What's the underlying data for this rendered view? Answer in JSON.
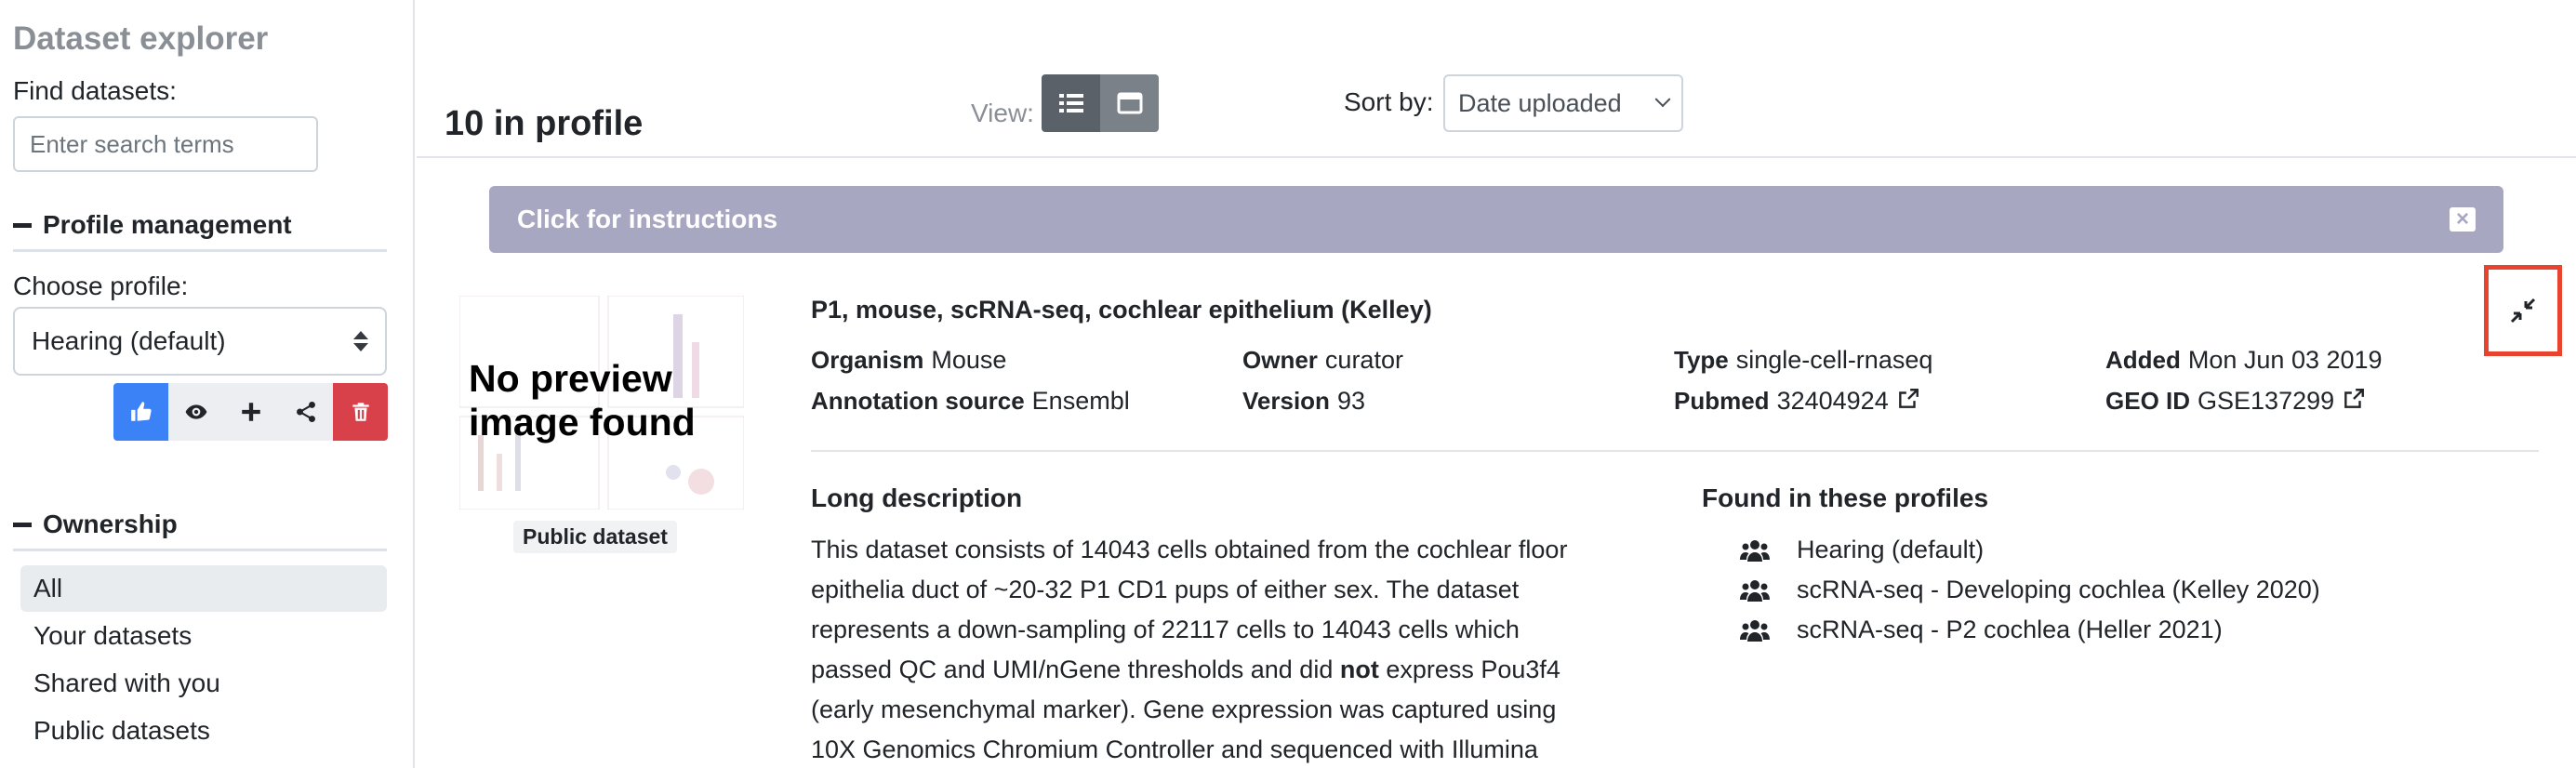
{
  "sidebar": {
    "app_title": "Dataset explorer",
    "find_label": "Find datasets:",
    "search_placeholder": "Enter search terms",
    "profile_section": "Profile management",
    "choose_profile_label": "Choose profile:",
    "selected_profile": "Hearing (default)",
    "profile_action_icons": [
      "thumbs-up-icon",
      "eye-icon",
      "plus-icon",
      "share-icon",
      "trash-icon"
    ],
    "ownership_section": "Ownership",
    "ownership_items": [
      {
        "label": "All",
        "active": true
      },
      {
        "label": "Your datasets",
        "active": false
      },
      {
        "label": "Shared with you",
        "active": false
      },
      {
        "label": "Public datasets",
        "active": false
      }
    ]
  },
  "toolbar": {
    "count_title": "10 in profile",
    "view_label": "View:",
    "view_modes": [
      "list-view-icon",
      "grid-view-icon"
    ],
    "sort_label": "Sort by:",
    "sort_value": "Date uploaded"
  },
  "instructions": {
    "label": "Click for instructions"
  },
  "dataset": {
    "preview_text_line1": "No preview",
    "preview_text_line2": "image found",
    "access": "Public dataset",
    "title": "P1, mouse, scRNA-seq, cochlear epithelium (Kelley)",
    "organism_label": "Organism",
    "organism": "Mouse",
    "annotation_label": "Annotation source",
    "annotation": "Ensembl",
    "owner_label": "Owner",
    "owner": "curator",
    "version_label": "Version",
    "version": "93",
    "type_label": "Type",
    "type": "single-cell-rnaseq",
    "pubmed_label": "Pubmed",
    "pubmed": "32404924",
    "added_label": "Added",
    "added": "Mon Jun 03 2019",
    "geo_label": "GEO ID",
    "geo": "GSE137299",
    "long_desc_heading": "Long description",
    "long_desc_lines": [
      "This dataset consists of 14043 cells obtained from the cochlear floor",
      "epithelia duct of ~20-32 P1 CD1 pups of either sex. The dataset",
      "represents a down-sampling of 22117 cells to 14043 cells which",
      "passed QC and UMI/nGene thresholds and did ",
      "not",
      " express Pou3f4",
      "(early mesenchymal marker). Gene expression was captured using",
      "10X Genomics Chromium Controller and sequenced with Illumina"
    ],
    "found_heading": "Found in these profiles",
    "found_profiles": [
      "Hearing (default)",
      "scRNA-seq - Developing cochlea (Kelley 2020)",
      "scRNA-seq - P2 cochlea (Heller 2021)"
    ]
  },
  "colors": {
    "primary": "#3b82f6",
    "danger": "#d9414a",
    "instructions_bg": "#a7a7c2",
    "highlight_box": "#e8432f"
  }
}
